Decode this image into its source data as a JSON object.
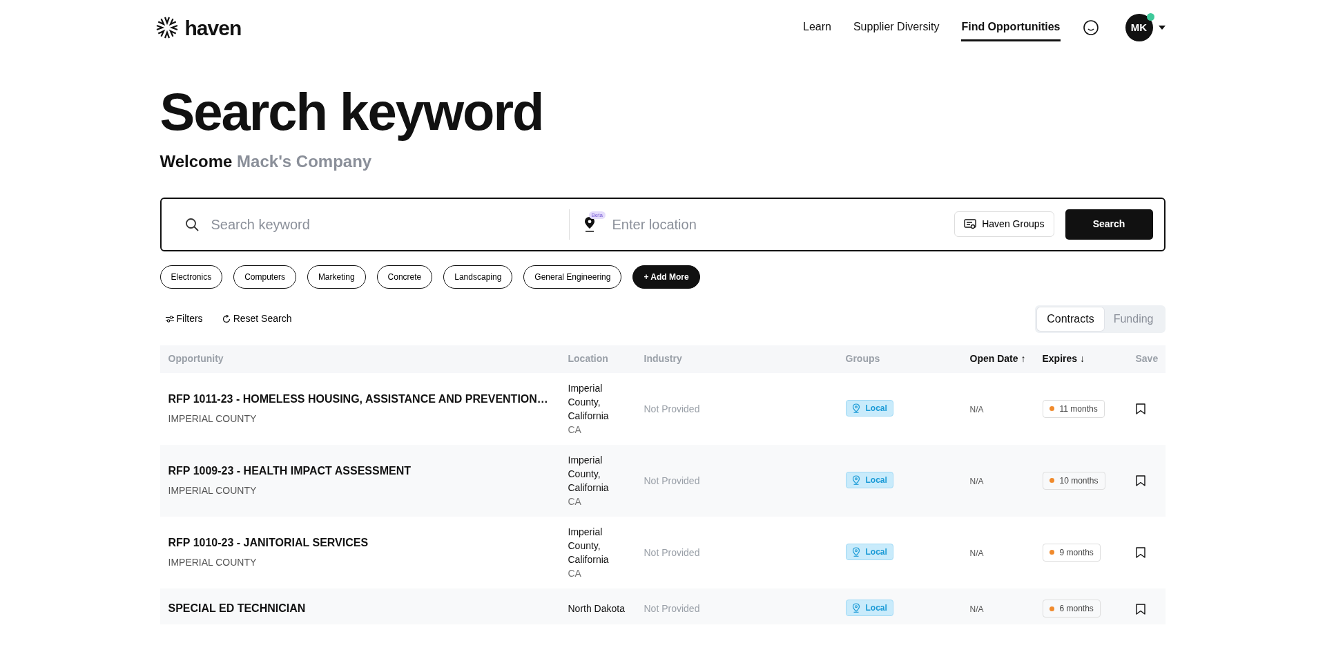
{
  "header": {
    "logo": "haven",
    "nav": [
      {
        "label": "Learn",
        "selected": false
      },
      {
        "label": "Supplier Diversity",
        "selected": false
      },
      {
        "label": "Find Opportunities",
        "selected": true
      }
    ],
    "avatar": {
      "initials": "MK",
      "online": true
    }
  },
  "heading": {
    "title": "Search keyword",
    "welcome": "Welcome",
    "company": "Mack's Company"
  },
  "search": {
    "keyword_placeholder": "Search keyword",
    "beta_badge": "Beta",
    "location_placeholder": "Enter location",
    "groups_button": "Haven Groups",
    "search_button": "Search"
  },
  "chips": [
    "Electronics",
    "Computers",
    "Marketing",
    "Concrete",
    "Landscaping",
    "General Engineering"
  ],
  "add_more": "+ Add More",
  "toolbar": {
    "filters": "Filters",
    "reset": "Reset Search"
  },
  "tabs": [
    {
      "label": "Contracts",
      "selected": true
    },
    {
      "label": "Funding",
      "selected": false
    }
  ],
  "table": {
    "columns": [
      {
        "label": "Opportunity"
      },
      {
        "label": "Location"
      },
      {
        "label": "Industry"
      },
      {
        "label": "Groups"
      },
      {
        "label": "Open Date",
        "sort_arrow": "↑"
      },
      {
        "label": "Expires",
        "sort_arrow": "↓"
      },
      {
        "label": "Save"
      }
    ],
    "rows": [
      {
        "title": "RFP 1011-23 - HOMELESS HOUSING, ASSISTANCE AND PREVENTION…",
        "agency": "IMPERIAL COUNTY",
        "location": "Imperial County, California",
        "state": "CA",
        "industry": "Not Provided",
        "group": "Local",
        "open_date": "N/A",
        "expires": "11 months",
        "saved": false
      },
      {
        "title": "RFP 1009-23 - HEALTH IMPACT ASSESSMENT",
        "agency": "IMPERIAL COUNTY",
        "location": "Imperial County, California",
        "state": "CA",
        "industry": "Not Provided",
        "group": "Local",
        "open_date": "N/A",
        "expires": "10 months",
        "saved": false
      },
      {
        "title": "RFP 1010-23 - JANITORIAL SERVICES",
        "agency": "IMPERIAL COUNTY",
        "location": "Imperial County, California",
        "state": "CA",
        "industry": "Not Provided",
        "group": "Local",
        "open_date": "N/A",
        "expires": "9 months",
        "saved": false
      },
      {
        "title": "SPECIAL ED TECHNICIAN",
        "location": "North Dakota",
        "industry": "Not Provided",
        "group": "Local",
        "open_date": "N/A",
        "expires": "6 months",
        "saved": false
      }
    ]
  }
}
